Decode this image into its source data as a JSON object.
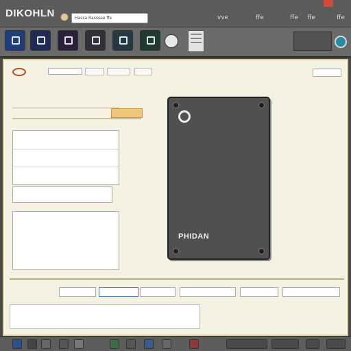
{
  "window": {
    "app_title": "DIKOHLN",
    "search_text": "Hassa Rasssee ffe",
    "controls": [
      "vve",
      "ffe",
      "ffe",
      "ffe",
      "ffe"
    ]
  },
  "device": {
    "brand": "PHIDAN"
  },
  "icons": {
    "home": "home-icon",
    "toolbar": [
      "app-icon",
      "page-icon",
      "doc-icon",
      "image-icon",
      "monitor-icon",
      "chart-icon"
    ],
    "globe": "globe-icon"
  }
}
